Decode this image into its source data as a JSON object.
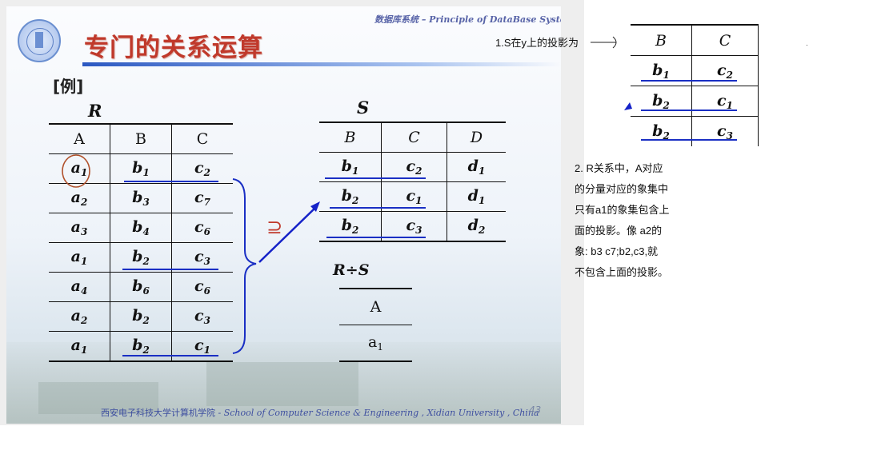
{
  "slide": {
    "header_right": "数据库系统 – Principle of DataBase System",
    "title": "专门的关系运算",
    "example_label": "[例]",
    "footer_cn": "西安电子科技大学计算机学院",
    "footer_en": " - School  of  Computer Science & Engineering , Xidian University , China",
    "page_number": "43",
    "superset_symbol": "⊇"
  },
  "relation_R": {
    "name": "R",
    "headers": [
      "A",
      "B",
      "C"
    ],
    "rows": [
      [
        [
          "a",
          "1"
        ],
        [
          "b",
          "1"
        ],
        [
          "c",
          "2"
        ]
      ],
      [
        [
          "a",
          "2"
        ],
        [
          "b",
          "3"
        ],
        [
          "c",
          "7"
        ]
      ],
      [
        [
          "a",
          "3"
        ],
        [
          "b",
          "4"
        ],
        [
          "c",
          "6"
        ]
      ],
      [
        [
          "a",
          "1"
        ],
        [
          "b",
          "2"
        ],
        [
          "c",
          "3"
        ]
      ],
      [
        [
          "a",
          "4"
        ],
        [
          "b",
          "6"
        ],
        [
          "c",
          "6"
        ]
      ],
      [
        [
          "a",
          "2"
        ],
        [
          "b",
          "2"
        ],
        [
          "c",
          "3"
        ]
      ],
      [
        [
          "a",
          "1"
        ],
        [
          "b",
          "2"
        ],
        [
          "c",
          "1"
        ]
      ]
    ]
  },
  "relation_S": {
    "name": "S",
    "headers": [
      "B",
      "C",
      "D"
    ],
    "rows": [
      [
        [
          "b",
          "1"
        ],
        [
          "c",
          "2"
        ],
        [
          "d",
          "1"
        ]
      ],
      [
        [
          "b",
          "2"
        ],
        [
          "c",
          "1"
        ],
        [
          "d",
          "1"
        ]
      ],
      [
        [
          "b",
          "2"
        ],
        [
          "c",
          "3"
        ],
        [
          "d",
          "2"
        ]
      ]
    ]
  },
  "division": {
    "name": "R÷S",
    "header": "A",
    "rows": [
      [
        [
          "a",
          "1"
        ]
      ]
    ]
  },
  "annotation": {
    "projection_label": "1.S在y上的投影为",
    "projection_table": {
      "headers": [
        "B",
        "C"
      ],
      "rows": [
        [
          [
            "b",
            "1"
          ],
          [
            "c",
            "2"
          ]
        ],
        [
          [
            "b",
            "2"
          ],
          [
            "c",
            "1"
          ]
        ],
        [
          [
            "b",
            "2"
          ],
          [
            "c",
            "3"
          ]
        ]
      ]
    },
    "explanation_lines": [
      "2. R关系中，A对应",
      "的分量对应的象集中",
      "只有a1的象集包含上",
      "面的投影。像 a2的",
      "象: b3 c7;b2,c3,就",
      "不包含上面的投影。"
    ]
  },
  "colors": {
    "title": "#c0392b",
    "underline": "#1a2fc4",
    "arrow": "#1522c8",
    "circle": "#b0502a",
    "footer": "#3e4fa0"
  }
}
